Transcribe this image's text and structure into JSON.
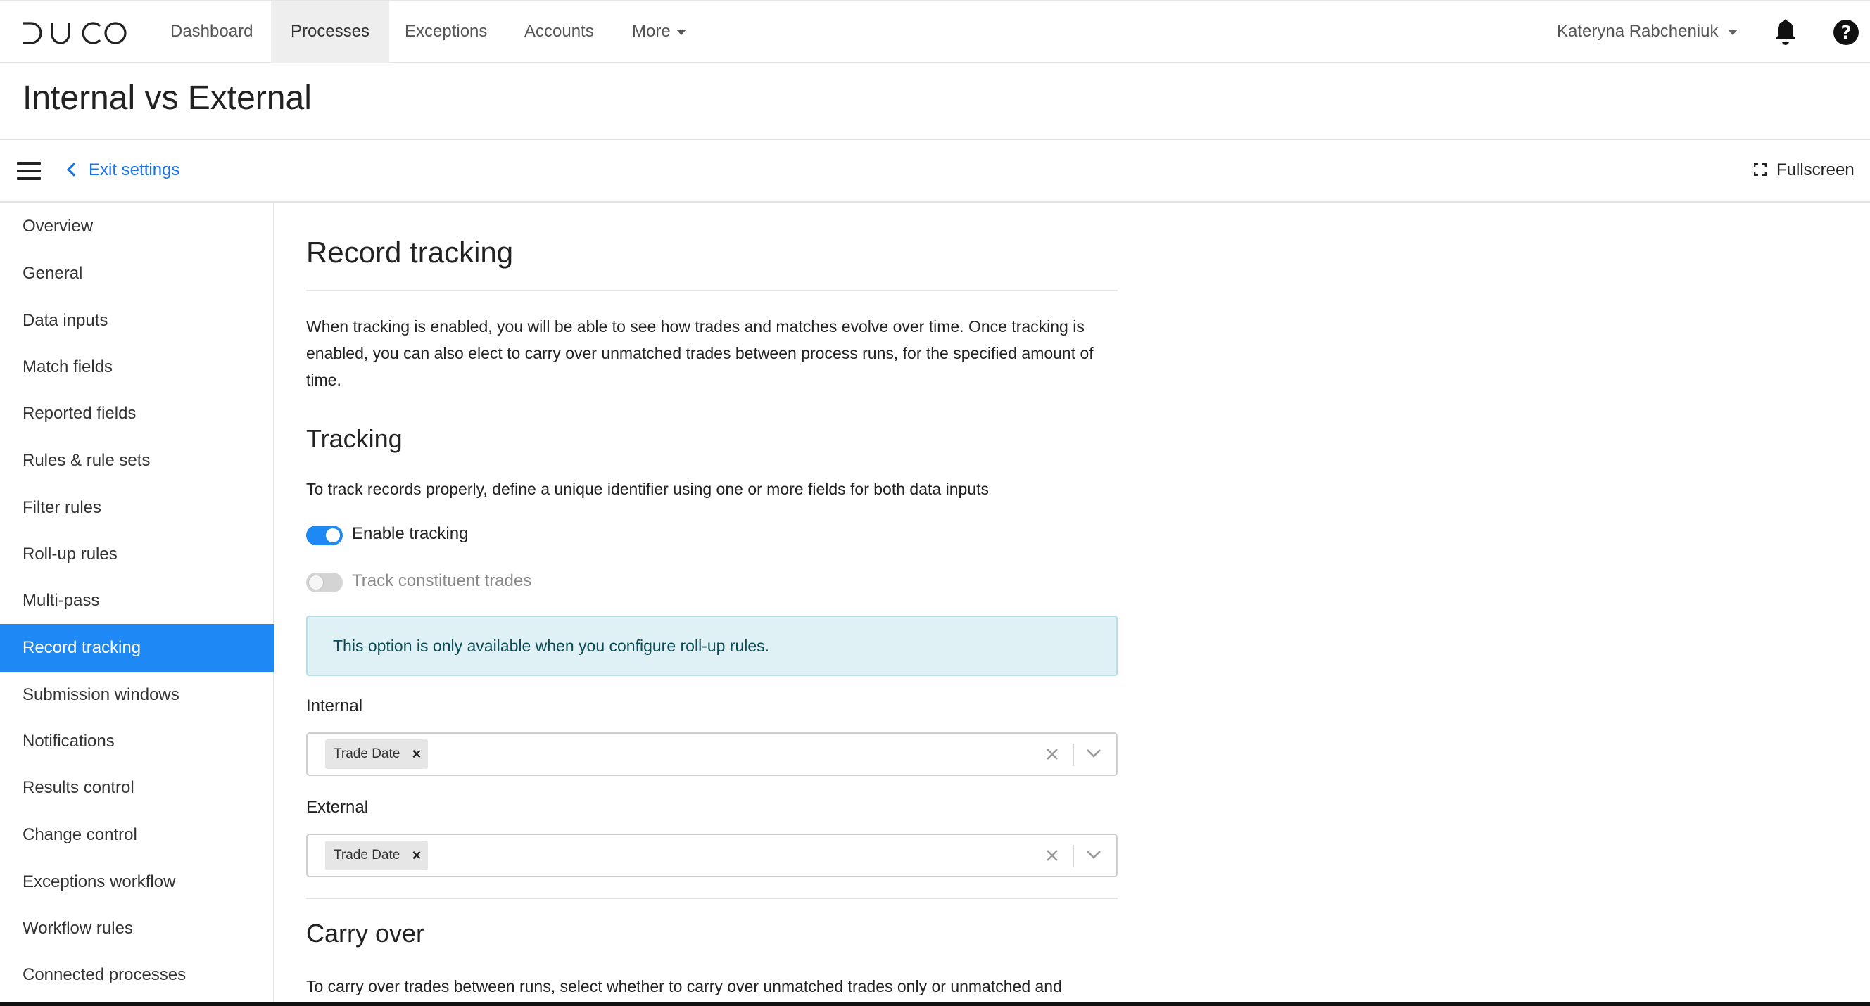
{
  "app": {
    "logo_text": "DUCO"
  },
  "topnav": {
    "items": [
      {
        "label": "Dashboard"
      },
      {
        "label": "Processes",
        "active": true
      },
      {
        "label": "Exceptions"
      },
      {
        "label": "Accounts"
      },
      {
        "label": "More"
      }
    ],
    "user_name": "Kateryna Rabcheniuk",
    "icons": [
      "bell-icon",
      "help-icon"
    ]
  },
  "page": {
    "title": "Internal vs External"
  },
  "settings_bar": {
    "exit_label": "Exit settings",
    "fullscreen_label": "Fullscreen"
  },
  "sidebar": {
    "items": [
      {
        "label": "Overview"
      },
      {
        "label": "General"
      },
      {
        "label": "Data inputs"
      },
      {
        "label": "Match fields"
      },
      {
        "label": "Reported fields"
      },
      {
        "label": "Rules & rule sets"
      },
      {
        "label": "Filter rules"
      },
      {
        "label": "Roll-up rules"
      },
      {
        "label": "Multi-pass"
      },
      {
        "label": "Record tracking",
        "active": true
      },
      {
        "label": "Submission windows"
      },
      {
        "label": "Notifications"
      },
      {
        "label": "Results control"
      },
      {
        "label": "Change control"
      },
      {
        "label": "Exceptions workflow"
      },
      {
        "label": "Workflow rules"
      },
      {
        "label": "Connected processes"
      }
    ]
  },
  "main": {
    "heading": "Record tracking",
    "description": "When tracking is enabled, you will be able to see how trades and matches evolve over time. Once tracking is enabled, you can also elect to carry over unmatched trades between process runs, for the specified amount of time.",
    "tracking": {
      "heading": "Tracking",
      "description": "To track records properly, define a unique identifier using one or more fields for both data inputs",
      "enable_tracking": {
        "label": "Enable tracking",
        "on": true
      },
      "track_constituent": {
        "label": "Track constituent trades",
        "on": false,
        "disabled": true
      },
      "info_text": "This option is only available when you configure roll-up rules."
    },
    "internal": {
      "label": "Internal",
      "chips": [
        "Trade Date"
      ]
    },
    "external": {
      "label": "External",
      "chips": [
        "Trade Date"
      ]
    },
    "carry_over": {
      "heading": "Carry over",
      "description": "To carry over trades between runs, select whether to carry over unmatched trades only or unmatched and"
    }
  },
  "colors": {
    "accent": "#1e88f5",
    "info_bg": "#dff1f4",
    "info_text": "#0b4a56"
  }
}
